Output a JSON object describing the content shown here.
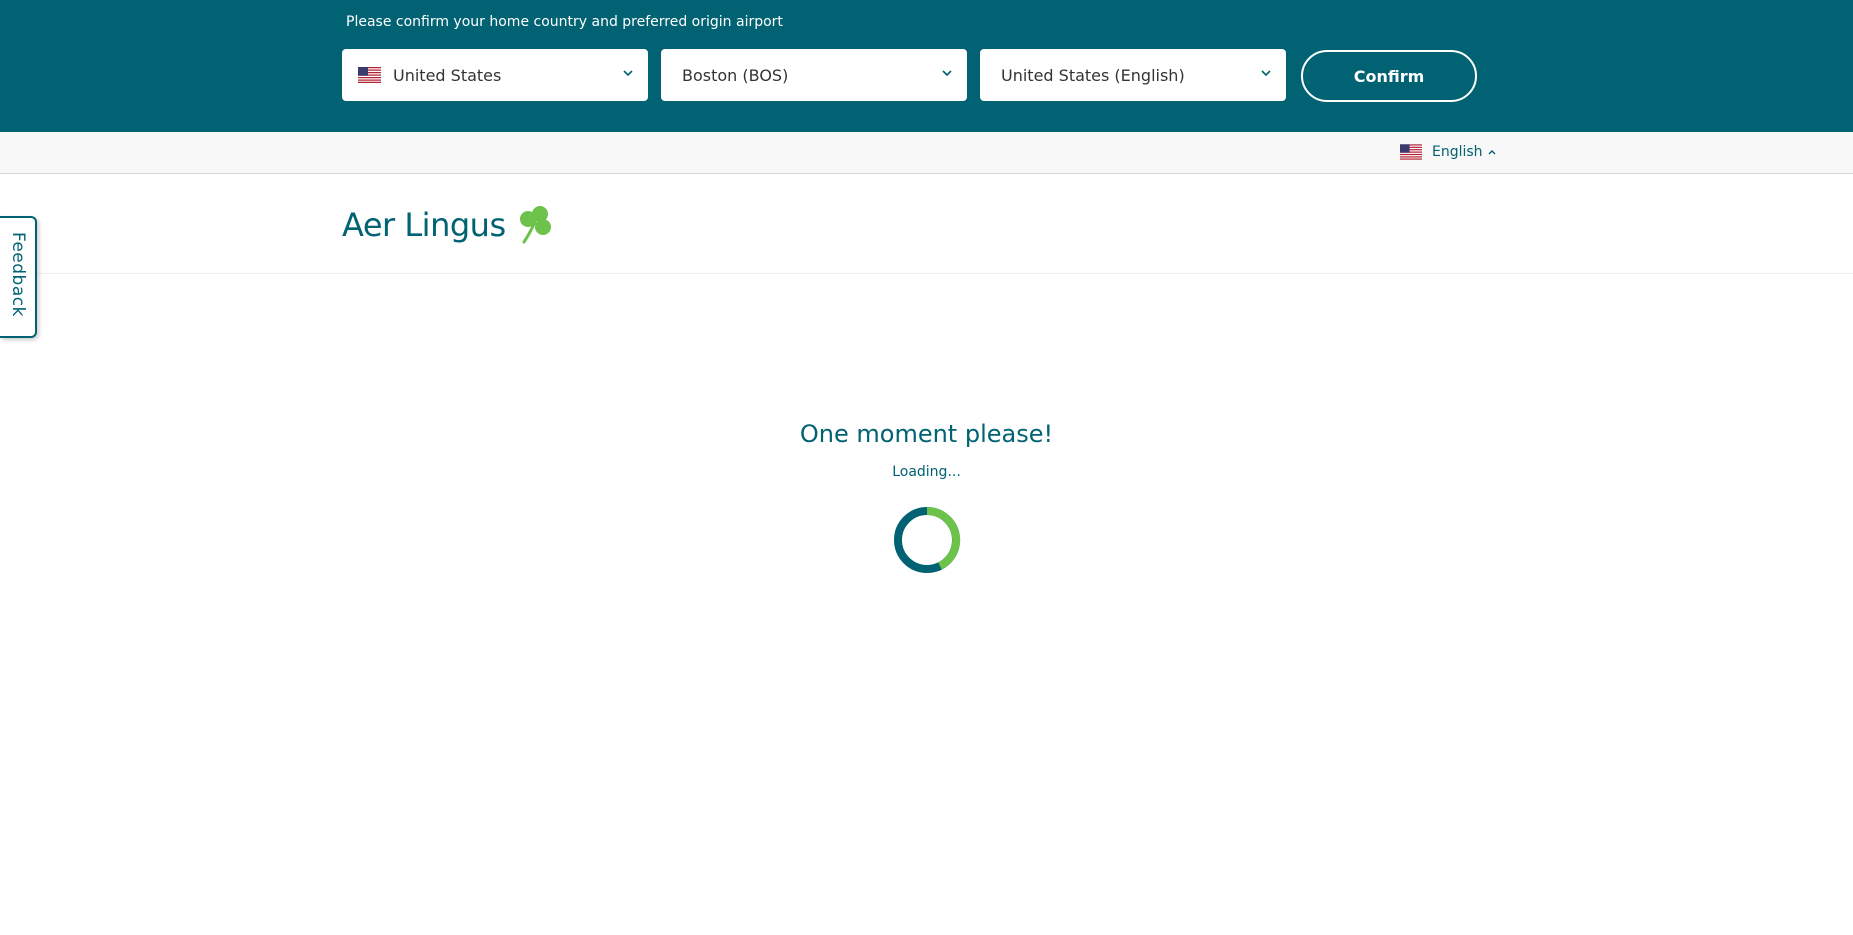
{
  "banner": {
    "prompt": "Please confirm your home country and preferred origin airport",
    "country_value": "United States",
    "airport_value": "Boston (BOS)",
    "language_value": "United States (English)",
    "confirm_label": "Confirm"
  },
  "utility_bar": {
    "language_label": "English"
  },
  "header": {
    "logo_text": "Aer Lingus"
  },
  "feedback_label": "Feedback",
  "loading": {
    "title": "One moment please!",
    "subtitle": "Loading..."
  },
  "colors": {
    "brand_teal": "#006272",
    "brand_green": "#6cc24a",
    "background": "#ffffff"
  },
  "icons": [
    "us-flag-icon",
    "chevron-down-icon",
    "chevron-up-icon",
    "shamrock-icon",
    "loading-spinner-icon"
  ]
}
